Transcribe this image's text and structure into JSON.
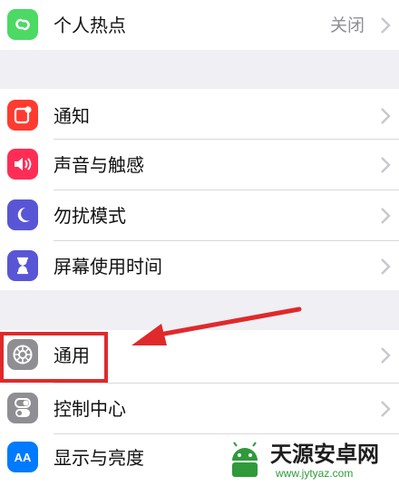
{
  "settings": {
    "hotspot": {
      "label": "个人热点",
      "value": "关闭"
    },
    "notifications": {
      "label": "通知"
    },
    "sounds": {
      "label": "声音与触感"
    },
    "dnd": {
      "label": "勿扰模式"
    },
    "screen_time": {
      "label": "屏幕使用时间"
    },
    "general": {
      "label": "通用"
    },
    "control_center": {
      "label": "控制中心"
    },
    "display": {
      "label": "显示与亮度",
      "icon_text": "AA"
    }
  },
  "watermark": {
    "title": "天源安卓网",
    "url": "www.jytyaz.com"
  },
  "colors": {
    "hotspot": "#4cd964",
    "notifications": "#ff3b30",
    "sounds": "#ff2d55",
    "dnd": "#5856d6",
    "screen_time": "#5856d6",
    "general": "#8e8e93",
    "control_center": "#8e8e93",
    "display": "#007aff",
    "highlight": "#e0292b",
    "watermark_green": "#2e9a3a"
  },
  "icons": [
    "link-icon",
    "notification-icon",
    "speaker-icon",
    "moon-icon",
    "hourglass-icon",
    "gear-icon",
    "toggles-icon",
    "text-size-icon"
  ]
}
